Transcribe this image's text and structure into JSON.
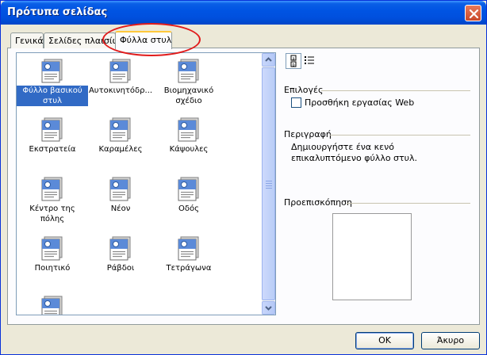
{
  "window": {
    "title": "Πρότυπα σελίδας"
  },
  "tabs": [
    {
      "label": "Γενικά"
    },
    {
      "label": "Σελίδες πλαισίων"
    },
    {
      "label": "Φύλλα στυλ"
    }
  ],
  "styles": [
    {
      "label": "Φύλλο βασικού στυλ",
      "selected": true
    },
    {
      "label": "Αυτοκινητόδρ..."
    },
    {
      "label": "Βιομηχανικό σχέδιο"
    },
    {
      "label": "Εκστρατεία"
    },
    {
      "label": "Καραμέλες"
    },
    {
      "label": "Κάψουλες"
    },
    {
      "label": "Κέντρο της πόλης"
    },
    {
      "label": "Νέον"
    },
    {
      "label": "Οδός"
    },
    {
      "label": "Ποιητικό"
    },
    {
      "label": "Ράβδοι"
    },
    {
      "label": "Τετράγωνα"
    },
    {
      "label": ""
    }
  ],
  "options": {
    "section_label": "Επιλογές",
    "web_checkbox_label": "Προσθήκη εργασίας Web",
    "web_checkbox_checked": false
  },
  "description": {
    "section_label": "Περιγραφή",
    "text": "Δημιουργήστε ένα κενό επικαλυπτόμενο φύλλο στυλ."
  },
  "preview": {
    "section_label": "Προεπισκόπηση"
  },
  "buttons": {
    "ok": "OK",
    "cancel": "Άκυρο"
  },
  "colors": {
    "title_bar": "#0054e3",
    "selection": "#316ac5",
    "highlight_circle": "#e11b1b"
  }
}
